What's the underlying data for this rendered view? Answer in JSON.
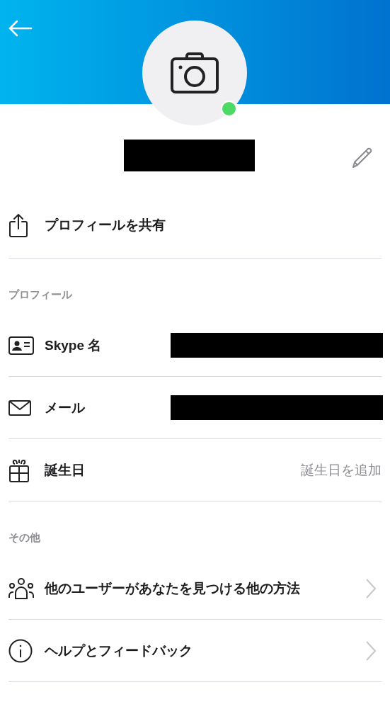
{
  "profile": {
    "online": true
  },
  "share": {
    "label": "プロフィールを共有"
  },
  "sections": [
    {
      "title": "プロフィール",
      "rows": [
        {
          "kind": "redacted",
          "label": "Skype 名"
        },
        {
          "kind": "redacted",
          "label": "メール"
        },
        {
          "kind": "action",
          "label": "誕生日",
          "action": "誕生日を追加"
        }
      ]
    },
    {
      "title": "その他",
      "rows": [
        {
          "kind": "link",
          "label": "他のユーザーがあなたを見つける他の方法"
        },
        {
          "kind": "link",
          "label": "ヘルプとフィードバック"
        }
      ]
    }
  ]
}
